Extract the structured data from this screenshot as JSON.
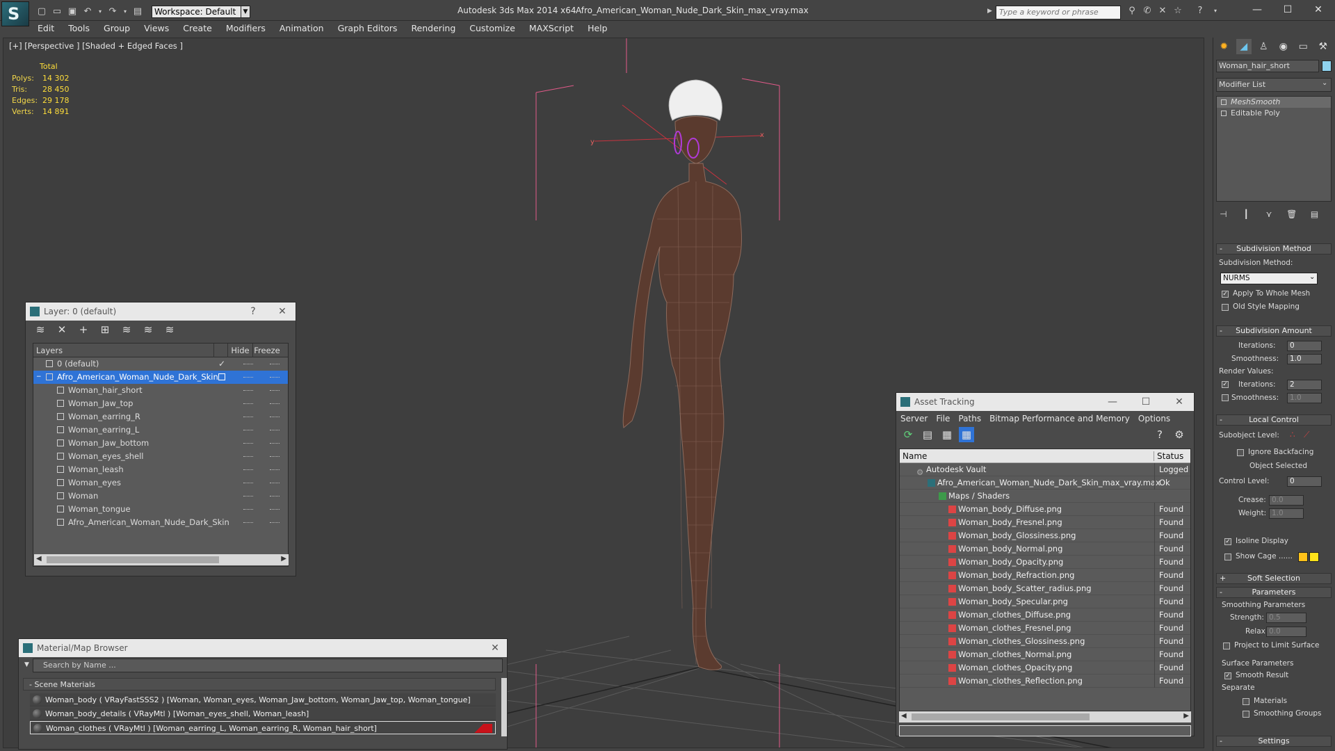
{
  "titlebar": {
    "app_title": "Autodesk 3ds Max  2014 x64",
    "file_title": "Afro_American_Woman_Nude_Dark_Skin_max_vray.max",
    "workspace": "Workspace: Default",
    "search_placeholder": "Type a keyword or phrase",
    "logo": "S"
  },
  "menu": [
    "Edit",
    "Tools",
    "Group",
    "Views",
    "Create",
    "Modifiers",
    "Animation",
    "Graph Editors",
    "Rendering",
    "Customize",
    "MAXScript",
    "Help"
  ],
  "viewport": {
    "label": "[+] [Perspective ] [Shaded + Edged Faces ]",
    "stats_total": "Total",
    "stats": [
      {
        "label": "Polys:",
        "value": "14 302"
      },
      {
        "label": "Tris:",
        "value": "28 450"
      },
      {
        "label": "Edges:",
        "value": "29 178"
      },
      {
        "label": "Verts:",
        "value": "14 891"
      }
    ],
    "axis_x": "x",
    "axis_y": "y"
  },
  "layer_window": {
    "title": "Layer: 0 (default)",
    "help": "?",
    "close": "✕",
    "col_layers": "Layers",
    "col_hide": "Hide",
    "col_freeze": "Freeze",
    "default_layer": "0 (default)",
    "selected_layer": "Afro_American_Woman_Nude_Dark_Skin",
    "children": [
      "Woman_hair_short",
      "Woman_Jaw_top",
      "Woman_earring_R",
      "Woman_earring_L",
      "Woman_Jaw_bottom",
      "Woman_eyes_shell",
      "Woman_leash",
      "Woman_eyes",
      "Woman",
      "Woman_tongue",
      "Afro_American_Woman_Nude_Dark_Skin"
    ]
  },
  "material_browser": {
    "title": "Material/Map Browser",
    "close": "✕",
    "search_placeholder": "Search by Name ...",
    "section": "- Scene Materials",
    "materials": [
      "Woman_body  ( VRayFastSSS2 ) [Woman, Woman_eyes, Woman_Jaw_bottom, Woman_Jaw_top, Woman_tongue]",
      "Woman_body_details  ( VRayMtl ) [Woman_eyes_shell, Woman_leash]",
      "Woman_clothes  ( VRayMtl ) [Woman_earring_L, Woman_earring_R, Woman_hair_short]"
    ]
  },
  "asset_tracking": {
    "title": "Asset Tracking",
    "menu": [
      "Server",
      "File",
      "Paths",
      "Bitmap Performance and Memory",
      "Options"
    ],
    "col_name": "Name",
    "col_status": "Status",
    "vault": {
      "name": "Autodesk Vault",
      "status": "Logged O"
    },
    "file": {
      "name": "Afro_American_Woman_Nude_Dark_Skin_max_vray.max",
      "status": "Ok"
    },
    "group": "Maps / Shaders",
    "maps": [
      {
        "name": "Woman_body_Diffuse.png",
        "status": "Found"
      },
      {
        "name": "Woman_body_Fresnel.png",
        "status": "Found"
      },
      {
        "name": "Woman_body_Glossiness.png",
        "status": "Found"
      },
      {
        "name": "Woman_body_Normal.png",
        "status": "Found"
      },
      {
        "name": "Woman_body_Opacity.png",
        "status": "Found"
      },
      {
        "name": "Woman_body_Refraction.png",
        "status": "Found"
      },
      {
        "name": "Woman_body_Scatter_radius.png",
        "status": "Found"
      },
      {
        "name": "Woman_body_Specular.png",
        "status": "Found"
      },
      {
        "name": "Woman_clothes_Diffuse.png",
        "status": "Found"
      },
      {
        "name": "Woman_clothes_Fresnel.png",
        "status": "Found"
      },
      {
        "name": "Woman_clothes_Glossiness.png",
        "status": "Found"
      },
      {
        "name": "Woman_clothes_Normal.png",
        "status": "Found"
      },
      {
        "name": "Woman_clothes_Opacity.png",
        "status": "Found"
      },
      {
        "name": "Woman_clothes_Reflection.png",
        "status": "Found"
      }
    ]
  },
  "command_panel": {
    "object_name": "Woman_hair_short",
    "modifier_list": "Modifier List",
    "stack": [
      "MeshSmooth",
      "Editable Poly"
    ],
    "subdivision_method": {
      "rollout": "Subdivision Method",
      "label": "Subdivision Method:",
      "value": "NURMS",
      "apply_whole_mesh": "Apply To Whole Mesh",
      "old_style": "Old Style Mapping"
    },
    "subdivision_amount": {
      "rollout": "Subdivision Amount",
      "iterations_label": "Iterations:",
      "iterations": "0",
      "smoothness_label": "Smoothness:",
      "smoothness": "1.0",
      "render_values": "Render Values:",
      "render_iterations": "2",
      "render_smoothness": "1.0"
    },
    "local_control": {
      "rollout": "Local Control",
      "subobject": "Subobject Level:",
      "ignore_backfacing": "Ignore Backfacing",
      "object_selected": "Object Selected",
      "control_level_label": "Control Level:",
      "control_level": "0",
      "crease_label": "Crease:",
      "crease": "0.0",
      "weight_label": "Weight:",
      "weight": "1.0",
      "isoline": "Isoline Display",
      "show_cage": "Show Cage ......"
    },
    "soft_selection": "Soft Selection",
    "parameters": {
      "rollout": "Parameters",
      "smoothing": "Smoothing Parameters",
      "strength_label": "Strength:",
      "strength": "0.5",
      "relax_label": "Relax:",
      "relax": "0.0",
      "project": "Project to Limit Surface",
      "surface": "Surface Parameters",
      "smooth_result": "Smooth Result",
      "separate": "Separate",
      "materials": "Materials",
      "smoothing_groups": "Smoothing Groups"
    },
    "settings": "Settings"
  },
  "colors": {
    "selection_blue": "#2f73d6",
    "stats_yellow": "#ffde3a",
    "cage_a": "#ffc21a",
    "cage_b": "#ffe31a",
    "object_color": "#8fd3ef"
  }
}
